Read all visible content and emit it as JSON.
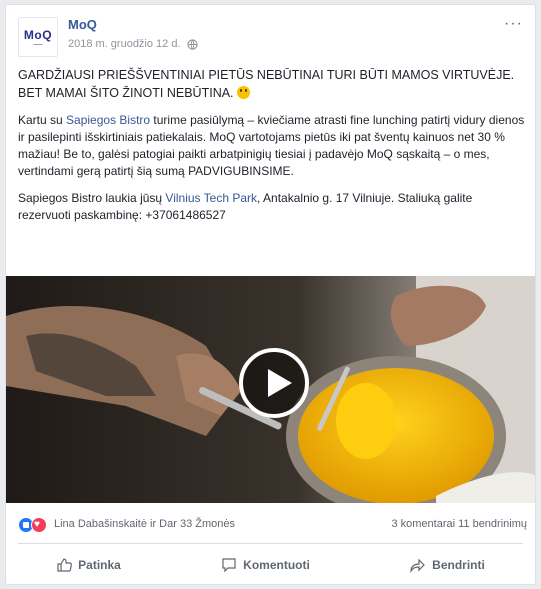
{
  "post": {
    "page_name": "MoQ",
    "avatar": {
      "logo": "MoQ"
    },
    "date": "2018 m. gruodžio 12 d.",
    "more": "···",
    "headline": "GARDŽIAUSI PRIEŠŠVENTINIAI PIETŪS NEBŪTINAI TURI BŪTI MAMOS VIRTUVĖJE. BET MAMAI ŠITO ŽINOTI NEBŪTINA.",
    "body1_a": "Kartu su ",
    "body1_link": "Sapiegos Bistro",
    "body1_b": " turime pasiūlymą – kviečiame atrasti fine lunching patirtį vidury dienos ir pasilepinti išskirtiniais patiekalais. MoQ vartotojams pietūs iki pat šventų kainuos net 30 % mažiau! Be to, galėsi patogiai paikti arbatpinigių tiesiai į padavėjo MoQ sąskaitą – o mes, vertindami gerą patirtį šią sumą PADVIGUBINSIME.",
    "body2_a": "Sapiegos Bistro laukia jūsų ",
    "body2_link": "Vilnius Tech Park",
    "body2_b": ", Antakalnio g. 17 Vilniuje. Staliuką galite rezervuoti paskambinę: +37061486527"
  },
  "reactions": {
    "names": "Lina Dabašinskaitė ir Dar 33 Žmonės",
    "stats": "3 komentarai  11 bendrinimų"
  },
  "actions": {
    "like": "Patinka",
    "comment": "Komentuoti",
    "share": "Bendrinti"
  },
  "colors": {
    "link": "#385898",
    "like": "#2078f4",
    "love": "#f33e58"
  }
}
